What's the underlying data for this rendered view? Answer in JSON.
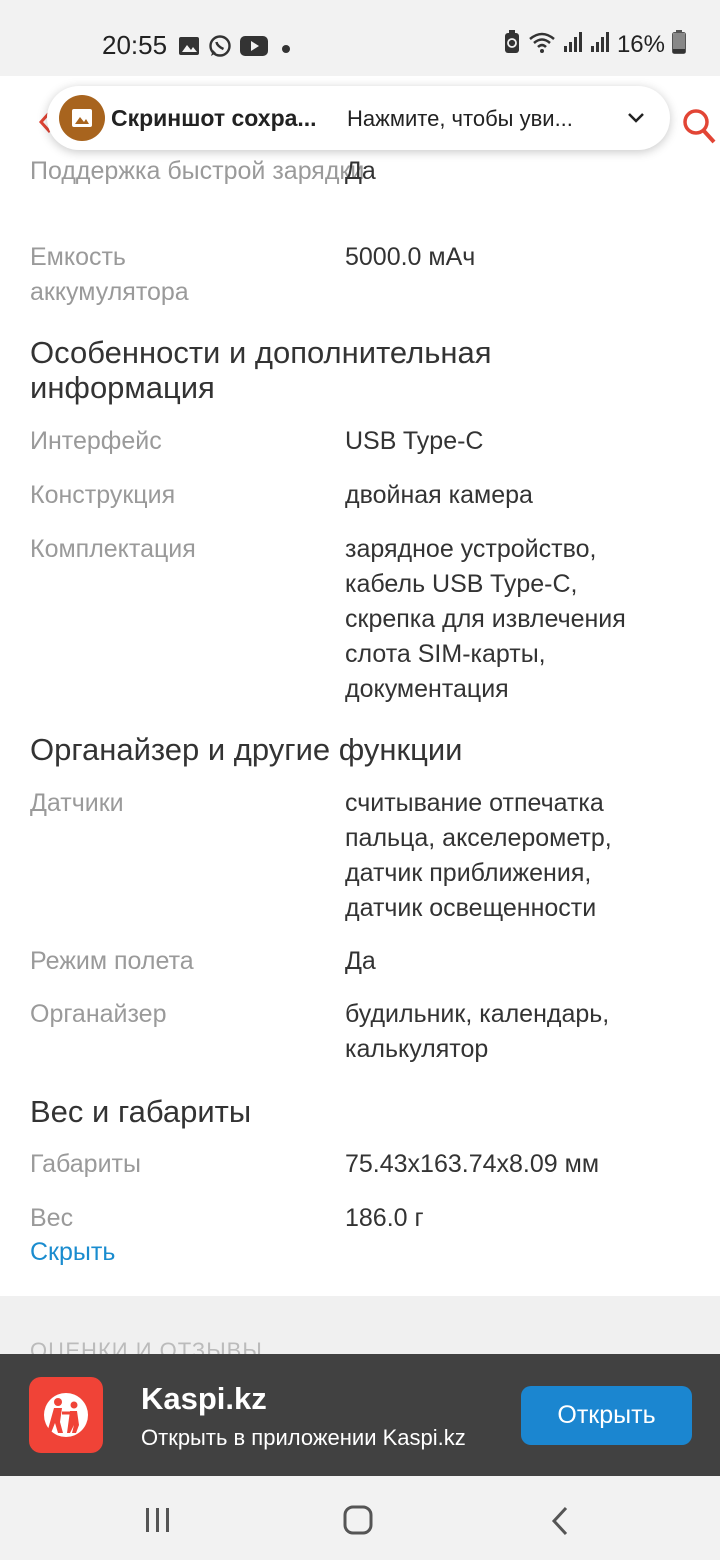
{
  "status_bar": {
    "time": "20:55",
    "battery": "16%",
    "icons_left": [
      "gallery-icon",
      "whatsapp-icon",
      "youtube-icon",
      "dot-icon"
    ],
    "icons_right": [
      "battery-saver-icon",
      "wifi-icon",
      "signal-icon",
      "signal-icon",
      "battery-icon"
    ]
  },
  "toast": {
    "title": "Скриншот сохра...",
    "action": "Нажмите, чтобы уви..."
  },
  "specs": {
    "charging": {
      "label": "Поддержка быстрой\nзарядки",
      "value": "Да"
    },
    "battery": {
      "label": "Емкость\nаккумулятора",
      "value": "5000.0 мАч"
    },
    "section_features": "Особенности и дополнительная\nинформация",
    "interface": {
      "label": "Интерфейс",
      "value": "USB Type-C"
    },
    "construction": {
      "label": "Конструкция",
      "value": "двойная камера"
    },
    "package": {
      "label": "Комплектация",
      "value": "зарядное устройство,\nкабель USB Type-C,\nскрепка для извлечения\nслота SIM-карты,\nдокументация"
    },
    "section_organizer": "Органайзер и другие функции",
    "sensors": {
      "label": "Датчики",
      "value": "считывание отпечатка\nпальца, акселерометр,\nдатчик приближения,\nдатчик освещенности"
    },
    "flight_mode": {
      "label": "Режим полета",
      "value": "Да"
    },
    "organizer": {
      "label": "Органайзер",
      "value": "будильник, календарь,\nкалькулятор"
    },
    "section_weight": "Вес и габариты",
    "dimensions": {
      "label": "Габариты",
      "value": "75.43x163.74x8.09 мм"
    },
    "weight": {
      "label": "Вес",
      "value": "186.0 г"
    },
    "hide_link": "Скрыть"
  },
  "reviews_heading": "ОЦЕНКИ И ОТЗЫВЫ",
  "app_banner": {
    "name": "Kaspi.kz",
    "description": "Открыть в приложении Kaspi.kz",
    "open_label": "Открыть"
  },
  "colors": {
    "link": "#1a8ccf",
    "banner_bg": "#414141",
    "open_button": "#1b86d0",
    "app_icon": "#f04337"
  }
}
